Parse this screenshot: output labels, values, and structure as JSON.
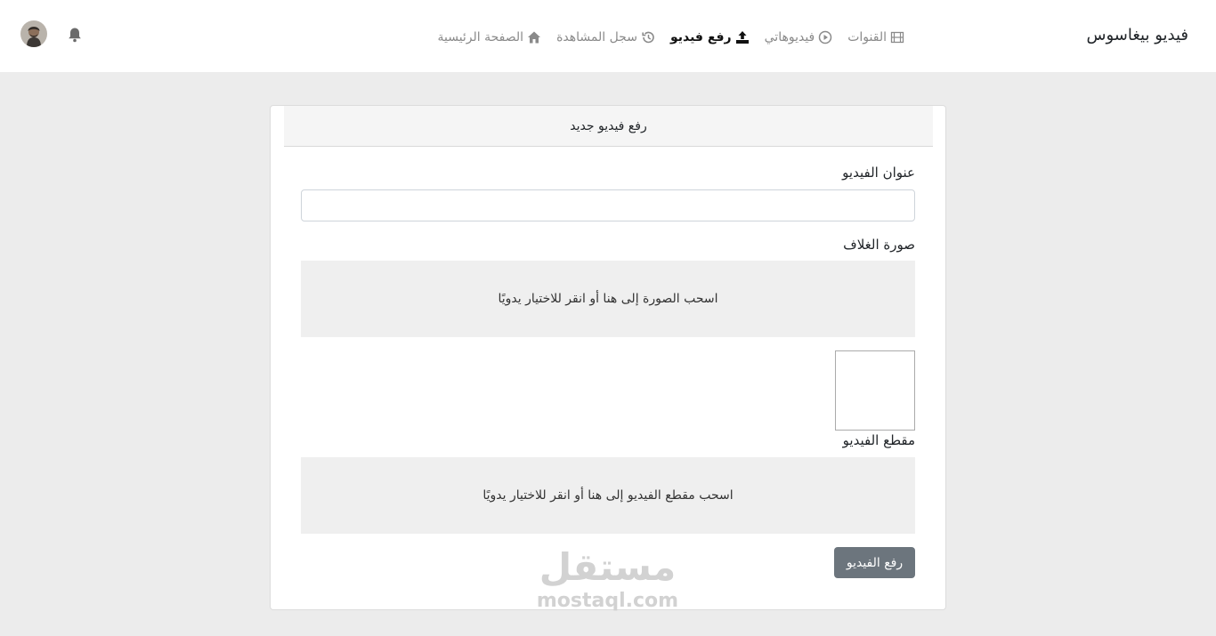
{
  "header": {
    "brand": "فيديو بيغاسوس",
    "nav": [
      {
        "label": "الصفحة الرئيسية",
        "icon": "home-icon",
        "active": false
      },
      {
        "label": "سجل المشاهدة",
        "icon": "history-icon",
        "active": false
      },
      {
        "label": "رفع فيديو",
        "icon": "upload-icon",
        "active": true
      },
      {
        "label": "فيديوهاتي",
        "icon": "play-circle-icon",
        "active": false
      },
      {
        "label": "القنوات",
        "icon": "film-icon",
        "active": false
      }
    ],
    "notifications_icon": "bell-icon",
    "avatar_icon": "user-avatar"
  },
  "form": {
    "header": "رفع فيديو جديد",
    "title_label": "عنوان الفيديو",
    "title_value": "",
    "cover_label": "صورة الغلاف",
    "cover_drop_text": "اسحب الصورة إلى هنا أو انقر للاختيار يدويًا",
    "video_label": "مقطع الفيديو",
    "video_drop_text": "اسحب مقطع الفيديو إلى هنا أو انقر للاختيار يدويًا",
    "submit_label": "رفع الفيديو"
  },
  "watermark": {
    "arabic": "مستقل",
    "latin": "mostaql.com"
  },
  "colors": {
    "background": "#ececec",
    "submit_button": "#6c757d",
    "dropzone": "#efefef"
  }
}
